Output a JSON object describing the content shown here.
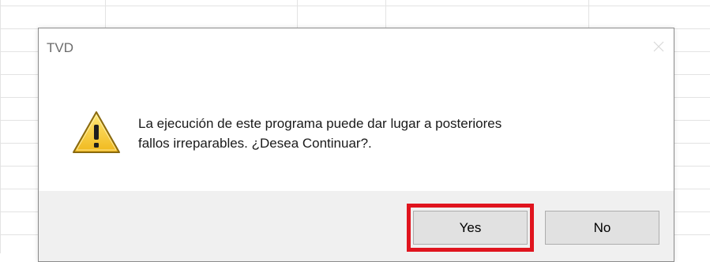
{
  "dialog": {
    "title": "TVD",
    "message_line1": "La ejecución de este programa puede dar lugar a posteriores",
    "message_line2": "fallos irreparables. ¿Desea Continuar?.",
    "icon": "warning-icon",
    "close_icon": "close-icon",
    "buttons": {
      "yes": "Yes",
      "no": "No"
    },
    "highlighted_button": "yes"
  },
  "colors": {
    "highlight": "#e0141e",
    "footer_bg": "#f0f0f0",
    "button_bg": "#e1e1e1"
  }
}
